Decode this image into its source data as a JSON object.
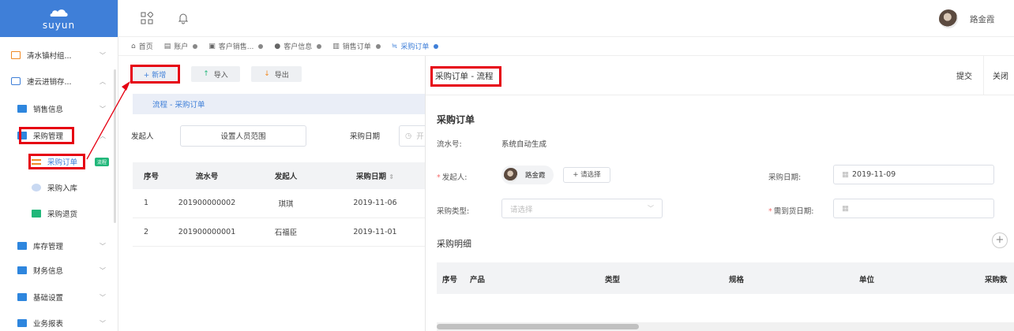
{
  "logo": {
    "brand": "suyun"
  },
  "sidebar": {
    "items": [
      {
        "label": "清水镇村组..."
      },
      {
        "label": "速云进销存..."
      },
      {
        "label": "销售信息"
      },
      {
        "label": "采购管理"
      },
      {
        "label": "采购订单",
        "badge": "流程"
      },
      {
        "label": "采购入库"
      },
      {
        "label": "采购退货"
      },
      {
        "label": "库存管理"
      },
      {
        "label": "财务信息"
      },
      {
        "label": "基础设置"
      },
      {
        "label": "业务报表"
      }
    ]
  },
  "header": {
    "user_name": "路金霞"
  },
  "tabs": [
    {
      "label": "首页"
    },
    {
      "label": "账户"
    },
    {
      "label": "客户销售..."
    },
    {
      "label": "客户信息"
    },
    {
      "label": "销售订单"
    },
    {
      "label": "采购订单"
    }
  ],
  "toolbar": {
    "add_label": "+ 新增",
    "import_label": "导入",
    "export_label": "导出"
  },
  "flow_bar": {
    "text": "流程 - 采购订单"
  },
  "filter": {
    "initiator_label": "发起人",
    "initiator_button": "设置人员范围",
    "date_label": "采购日期",
    "date_partial": "开"
  },
  "table": {
    "columns": [
      "序号",
      "流水号",
      "发起人",
      "采购日期"
    ],
    "rows": [
      [
        "1",
        "201900000002",
        "琪琪",
        "2019-11-06"
      ],
      [
        "2",
        "201900000001",
        "石福臣",
        "2019-11-01"
      ]
    ]
  },
  "panel": {
    "title": "采购订单 - 流程",
    "submit_label": "提交",
    "close_label": "关闭",
    "section_title": "采购订单",
    "serial_label": "流水号:",
    "serial_value": "系统自动生成",
    "initiator_label": "发起人:",
    "initiator_name": "路金霞",
    "choose_button": "+ 请选择",
    "date_label": "采购日期:",
    "date_value": "2019-11-09",
    "type_label": "采购类型:",
    "type_placeholder": "请选择",
    "delivery_label": "需到货日期:",
    "detail_title": "采购明细",
    "detail_columns": [
      "序号",
      "产品",
      "类型",
      "规格",
      "单位",
      "采购数"
    ]
  },
  "colors": {
    "primary": "#3f7fd8",
    "highlight": "#e60012",
    "badge": "#21b77a"
  }
}
